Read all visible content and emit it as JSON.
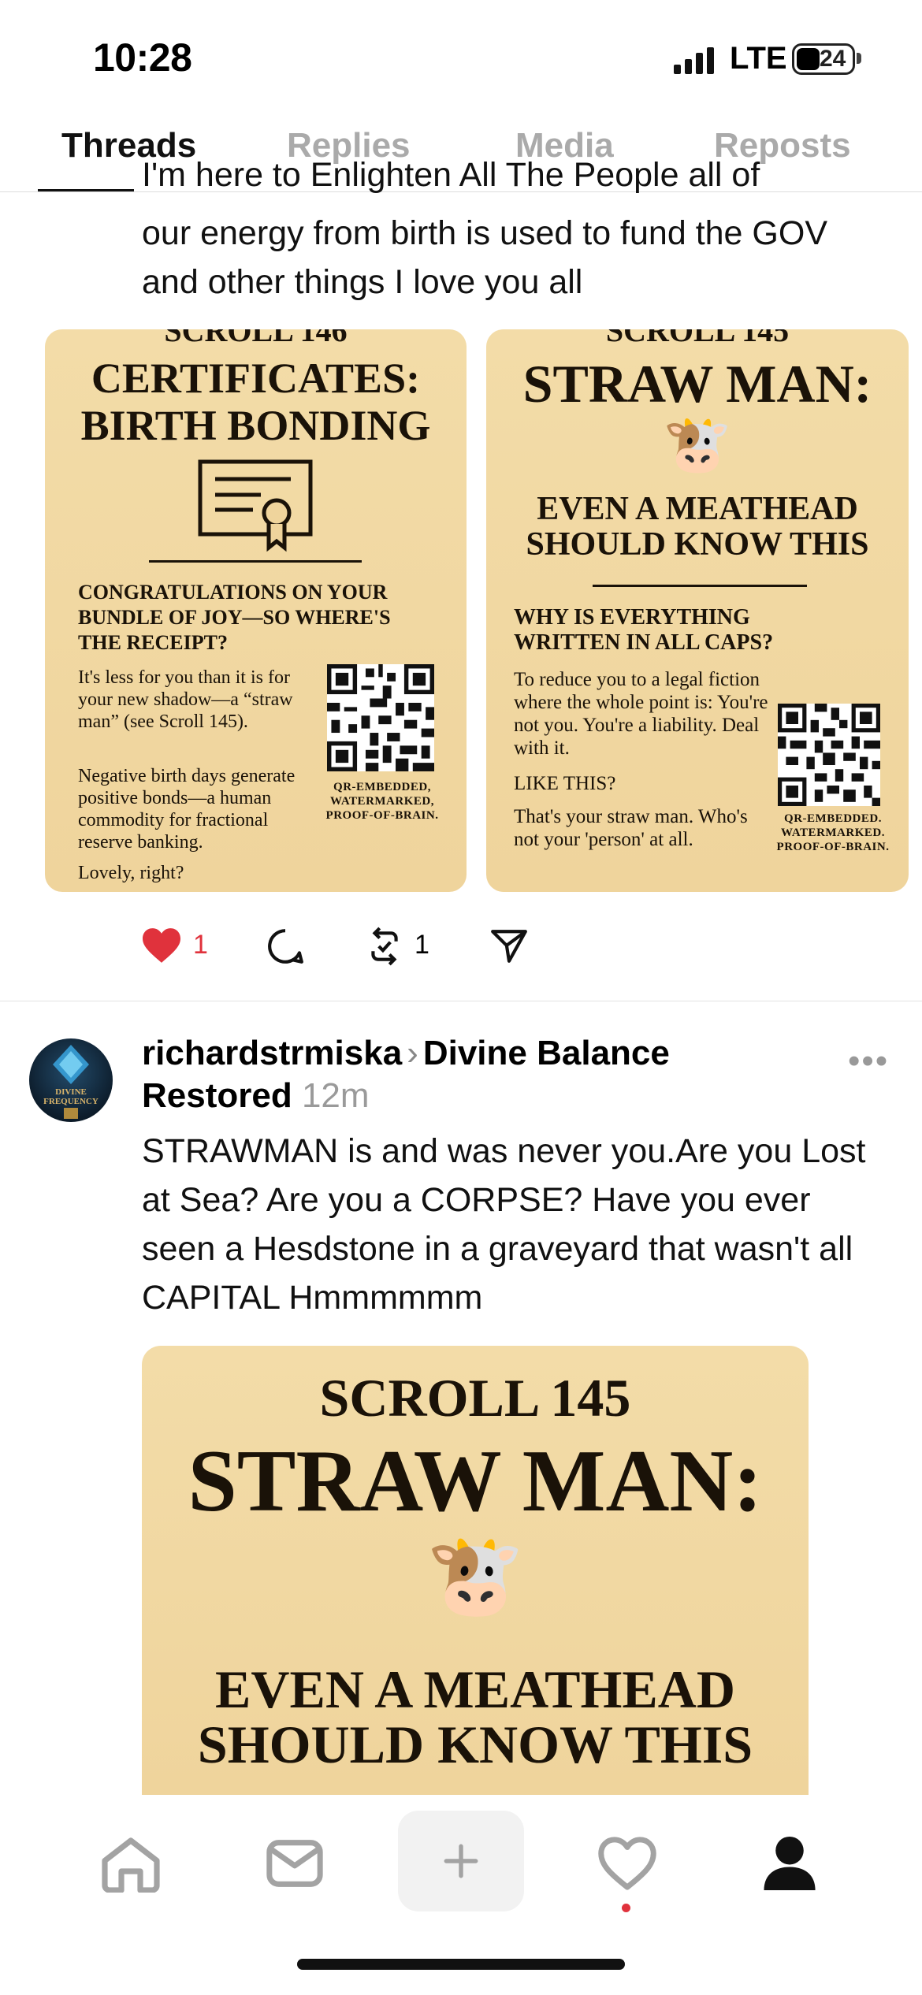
{
  "status": {
    "time": "10:28",
    "network": "LTE",
    "battery": "24"
  },
  "tabs": [
    {
      "label": "Threads",
      "active": true
    },
    {
      "label": "Replies",
      "active": false
    },
    {
      "label": "Media",
      "active": false
    },
    {
      "label": "Reposts",
      "active": false
    }
  ],
  "post1": {
    "text_cut": "I'm here to Enlighten All The People all of",
    "text": "our energy from birth is used to fund the GOV and other things  I love you all",
    "card1": {
      "scroll": "SCROLL 146",
      "title1": "CERTIFICATES:",
      "title2": "BIRTH BONDING",
      "heading": "CONGRATULATIONS ON YOUR BUNDLE OF JOY—SO WHERE'S THE RECEIPT?",
      "para1": "It's less for you than it is for your new shadow—a “straw man” (see Scroll 145).",
      "para2": "Negative birth days generate positive bonds—a human commodity for fractional reserve banking.",
      "para3": "Lovely, right?",
      "qr_label": "QR-EMBEDDED, WATERMARKED, PROOF-OF-BRAIN."
    },
    "card2": {
      "scroll": "SCROLL 145",
      "title": "STRAW MAN:",
      "emoji": "🐮",
      "sub1": "EVEN A MEATHEAD",
      "sub2": "SHOULD KNOW THIS",
      "heading": "WHY IS EVERYTHING WRITTEN IN ALL CAPS?",
      "para1": "To reduce you to a legal fiction where the whole point is: You're not you. You're a liability. Deal with it.",
      "para2": "LIKE THIS?",
      "para3": "That's your straw man. Who's not your 'person' at all.",
      "qr_label": "QR-EMBEDDED. WATERMARKED. PROOF-OF-BRAIN."
    },
    "likes": "1",
    "reposts": "1",
    "like_color": "#e0323c"
  },
  "post2": {
    "avatar_text": "DIVINE FREQUENCY",
    "author": "richardstrmiska",
    "community1": "Divine Balance",
    "community2": "Restored",
    "time": "12m",
    "text": "STRAWMAN is and was never you.Are you Lost at Sea? Are you a CORPSE?  Have you ever seen a Hesdstone in a graveyard that wasn't all CAPITAL Hmmmmmm",
    "card": {
      "scroll": "SCROLL 145",
      "title": "STRAW MAN:",
      "emoji": "🐮",
      "sub1": "EVEN A MEATHEAD",
      "sub2": "SHOULD KNOW THIS"
    }
  },
  "nav": {
    "icons": [
      "home-icon",
      "inbox-icon",
      "compose-icon",
      "activity-icon",
      "profile-icon"
    ],
    "activity_dot_color": "#e0323c"
  }
}
